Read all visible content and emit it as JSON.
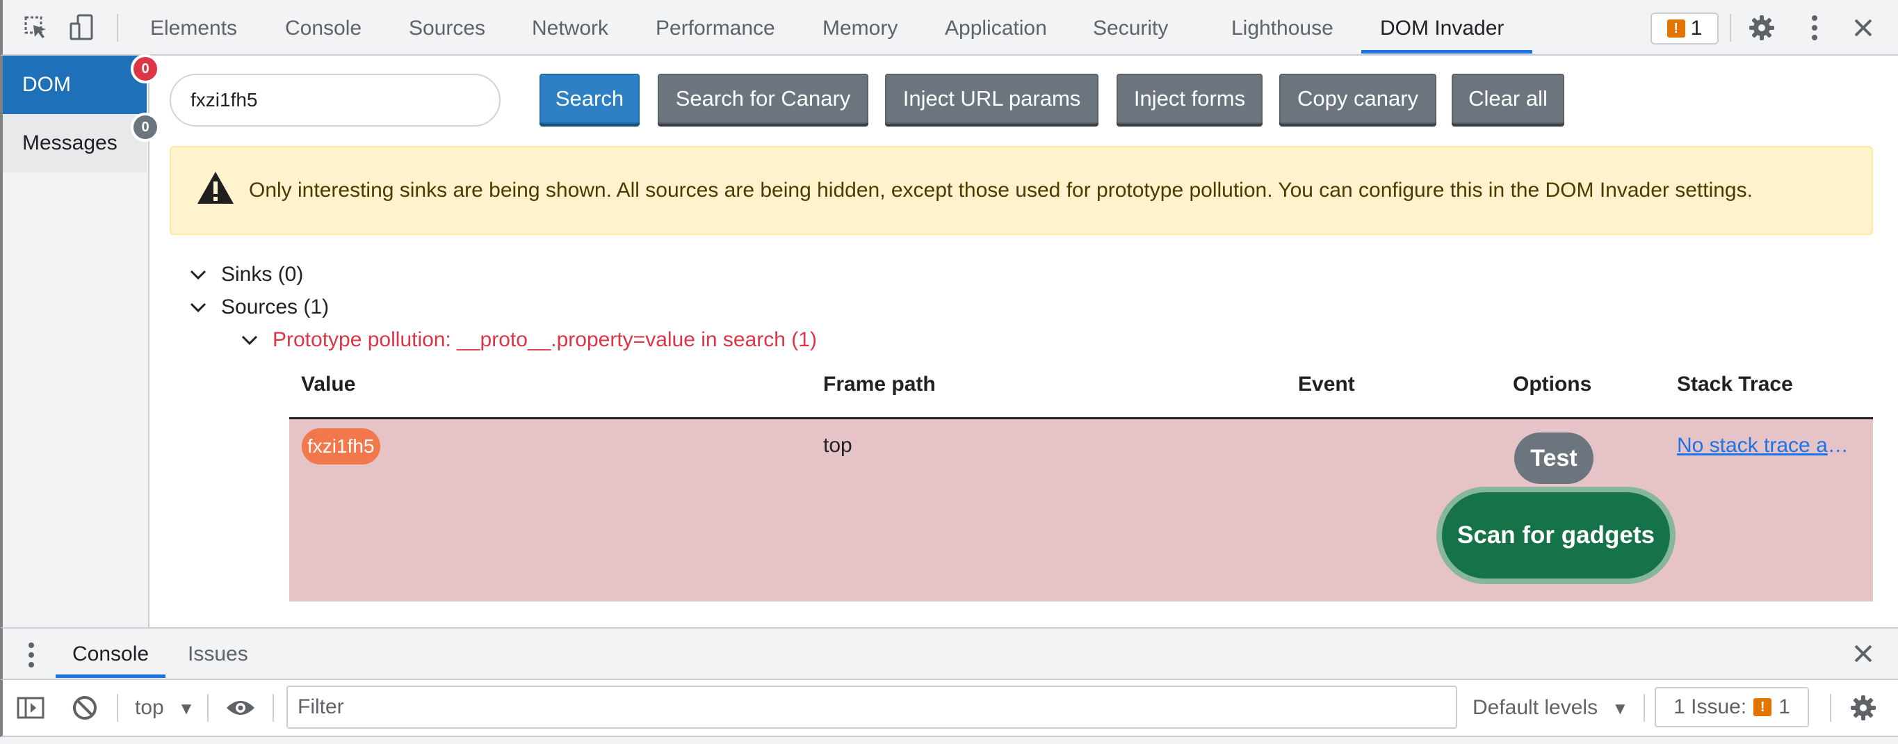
{
  "toolbar": {
    "tabs": [
      "Elements",
      "Console",
      "Sources",
      "Network",
      "Performance",
      "Memory",
      "Application",
      "Security",
      "Lighthouse",
      "DOM Invader"
    ],
    "active_tab": "DOM Invader",
    "issues_count": "1",
    "accent_color": "#1a73e8"
  },
  "sidebar": {
    "items": [
      {
        "label": "DOM",
        "badge": "0",
        "badge_color": "#dc3545"
      },
      {
        "label": "Messages",
        "badge": "0",
        "badge_color": "#6c757d"
      }
    ]
  },
  "search": {
    "value": "fxzi1fh5"
  },
  "buttons": {
    "search": "Search",
    "search_canary": "Search for Canary",
    "inject_url": "Inject URL params",
    "inject_forms": "Inject forms",
    "copy_canary": "Copy canary",
    "clear_all": "Clear all"
  },
  "alert": {
    "text": "Only interesting sinks are being shown. All sources are being hidden, except those used for prototype pollution. You can configure this in the DOM Invader settings.",
    "icon": "warning-icon"
  },
  "tree": {
    "sinks": "Sinks (0)",
    "sources": "Sources (1)",
    "pollution": "Prototype pollution: __proto__.property=value in search (1)"
  },
  "table": {
    "headers": [
      "Value",
      "Frame path",
      "Event",
      "Options",
      "Stack Trace"
    ],
    "row": {
      "value": "fxzi1fh5",
      "frame_path": "top",
      "event": "",
      "test": "Test",
      "scan": "Scan for gadgets",
      "stack": "No stack trace available"
    }
  },
  "drawer": {
    "tabs": [
      "Console",
      "Issues"
    ],
    "active_tab": "Console",
    "context": "top",
    "filter_placeholder": "Filter",
    "levels": "Default levels",
    "issues_label": "1 Issue:",
    "issues_count": "1"
  }
}
